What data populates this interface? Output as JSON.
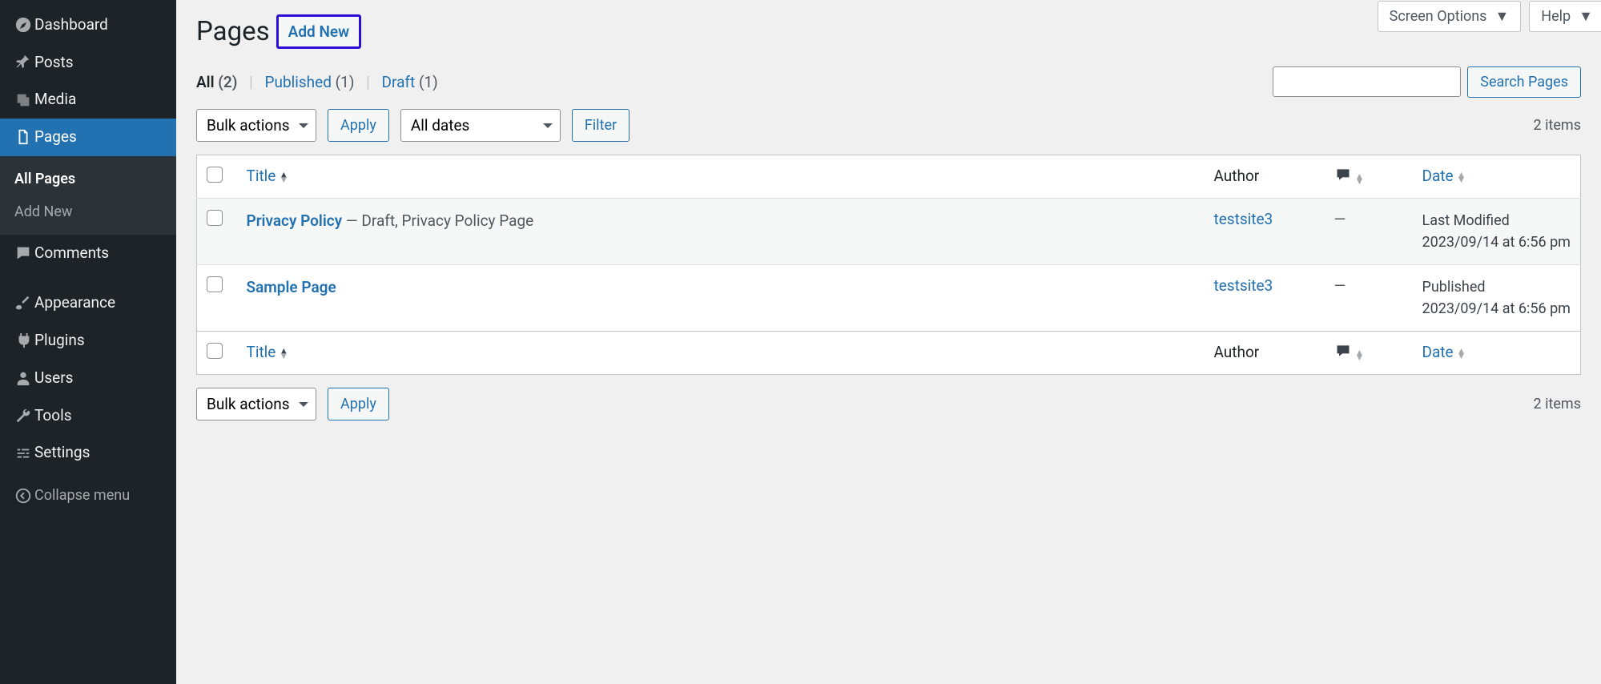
{
  "sidebar": {
    "dashboard": "Dashboard",
    "posts": "Posts",
    "media": "Media",
    "pages": "Pages",
    "all_pages": "All Pages",
    "add_new": "Add New",
    "comments": "Comments",
    "appearance": "Appearance",
    "plugins": "Plugins",
    "users": "Users",
    "tools": "Tools",
    "settings": "Settings",
    "collapse": "Collapse menu"
  },
  "top": {
    "screen_options": "Screen Options",
    "help": "Help"
  },
  "header": {
    "title": "Pages",
    "add_new": "Add New"
  },
  "status_filters": {
    "all_label": "All",
    "all_count": "(2)",
    "published_label": "Published",
    "published_count": "(1)",
    "draft_label": "Draft",
    "draft_count": "(1)"
  },
  "search": {
    "button": "Search Pages"
  },
  "filters": {
    "bulk": "Bulk actions",
    "apply": "Apply",
    "all_dates": "All dates",
    "filter": "Filter",
    "items_count": "2 items"
  },
  "columns": {
    "title": "Title",
    "author": "Author",
    "date": "Date"
  },
  "rows": [
    {
      "title": "Privacy Policy",
      "suffix": " — Draft, Privacy Policy Page",
      "author": "testsite3",
      "comments": "—",
      "date_state": "Last Modified",
      "date_line": "2023/09/14 at 6:56 pm"
    },
    {
      "title": "Sample Page",
      "suffix": "",
      "author": "testsite3",
      "comments": "—",
      "date_state": "Published",
      "date_line": "2023/09/14 at 6:56 pm"
    }
  ]
}
